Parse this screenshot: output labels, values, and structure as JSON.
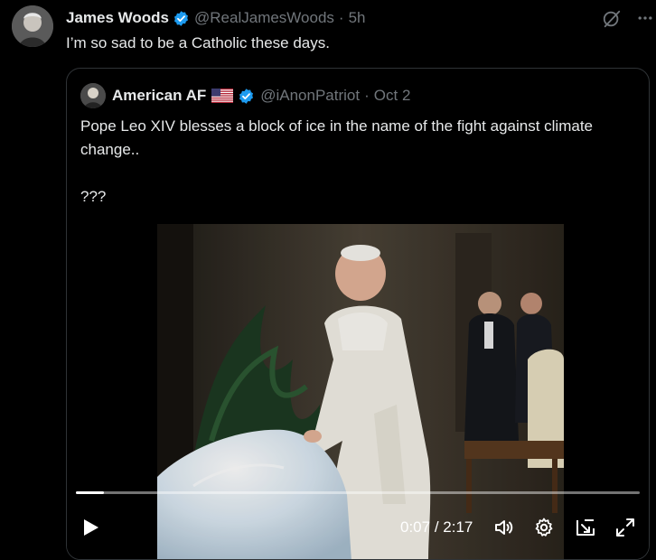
{
  "tweet": {
    "author_name": "James Woods",
    "author_handle": "@RealJamesWoods",
    "separator": "·",
    "time": "5h",
    "text": "I’m so sad to be a Catholic these days.",
    "avatar_icon": "avatar-photo",
    "verified_icon": "verified-badge-icon",
    "grok_icon": "grok-icon",
    "more_icon": "more-options-icon"
  },
  "quote": {
    "author_name": "American AF",
    "flag_icon": "us-flag-icon",
    "verified_icon": "verified-badge-icon",
    "author_handle": "@iAnonPatriot",
    "separator": "·",
    "date": "Oct 2",
    "text_line1": "Pope Leo XIV blesses a block of ice in the name of the fight against climate change..",
    "text_line2": "???"
  },
  "video": {
    "current_time": "0:07",
    "time_separator": " / ",
    "duration": "2:17",
    "progress_fraction": 0.05,
    "controls": {
      "play_icon": "play-icon",
      "volume_icon": "volume-icon",
      "settings_icon": "settings-gear-icon",
      "pip_icon": "picture-in-picture-icon",
      "fullscreen_icon": "fullscreen-icon"
    }
  },
  "colors": {
    "background": "#000000",
    "text_primary": "#e7e9ea",
    "text_secondary": "#71767b",
    "verified_blue": "#1d9bf0",
    "border": "#2f3336"
  }
}
